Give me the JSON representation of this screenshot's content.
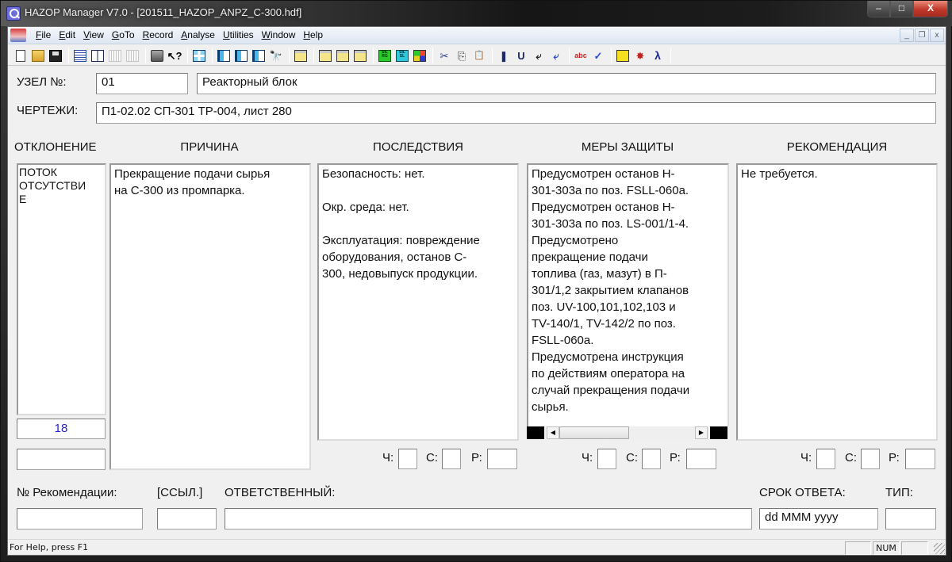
{
  "window": {
    "title": "HAZOP Manager V7.0 - [201511_HAZOP_ANPZ_C-300.hdf]",
    "controls": {
      "minimize": "–",
      "maximize": "□",
      "close": "X"
    },
    "mdi_controls": {
      "minimize": "_",
      "restore": "❐",
      "close": "x"
    }
  },
  "menu": {
    "items": [
      {
        "label": "File",
        "accel": "F",
        "rest": "ile"
      },
      {
        "label": "Edit",
        "accel": "E",
        "rest": "dit"
      },
      {
        "label": "View",
        "accel": "V",
        "rest": "iew"
      },
      {
        "label": "GoTo",
        "accel": "G",
        "rest": "oTo"
      },
      {
        "label": "Record",
        "accel": "R",
        "rest": "ecord"
      },
      {
        "label": "Analyse",
        "accel": "A",
        "rest": "nalyse"
      },
      {
        "label": "Utilities",
        "accel": "U",
        "rest": "tilities"
      },
      {
        "label": "Window",
        "accel": "W",
        "rest": "indow"
      },
      {
        "label": "Help",
        "accel": "H",
        "rest": "elp"
      }
    ]
  },
  "toolbar": {
    "buttons": [
      {
        "name": "new-document-icon"
      },
      {
        "name": "open-folder-icon"
      },
      {
        "name": "save-disk-icon"
      },
      {
        "name": "worksheet-list-icon"
      },
      {
        "name": "node-grid-icon"
      },
      {
        "name": "disabled-columns-icon"
      },
      {
        "name": "disabled-sign-icon"
      },
      {
        "name": "print-icon"
      },
      {
        "name": "context-help-icon",
        "glyph": "↖?"
      },
      {
        "name": "insert-record-icon"
      },
      {
        "name": "previous-record-icon"
      },
      {
        "name": "next-record-icon"
      },
      {
        "name": "goto-record-icon"
      },
      {
        "name": "find-number-icon",
        "glyph": "🔭"
      },
      {
        "name": "add-row-icon"
      },
      {
        "name": "highlight-icon"
      },
      {
        "name": "move-row-icon"
      },
      {
        "name": "resize-row-icon"
      },
      {
        "name": "sil-rg-icon",
        "glyph": "SIL RG"
      },
      {
        "name": "sil-sl-icon",
        "glyph": "SIL SL"
      },
      {
        "name": "risk-matrix-icon"
      },
      {
        "name": "cut-icon",
        "glyph": "✂"
      },
      {
        "name": "copy-icon",
        "glyph": "⎘"
      },
      {
        "name": "paste-icon",
        "glyph": "📋"
      },
      {
        "name": "bookmark-icon",
        "glyph": "❚"
      },
      {
        "name": "undo-icon",
        "glyph": "U"
      },
      {
        "name": "return-ar-icon",
        "glyph": "⤶"
      },
      {
        "name": "return-er-icon",
        "glyph": "⤶"
      },
      {
        "name": "find-text-icon",
        "glyph": "abc"
      },
      {
        "name": "spell-check-icon",
        "glyph": "✓"
      },
      {
        "name": "report-icon"
      },
      {
        "name": "db-explode-icon",
        "glyph": "✸"
      },
      {
        "name": "db-lambda-icon",
        "glyph": "λ"
      }
    ]
  },
  "node": {
    "label": "УЗЕЛ №:",
    "number": "01",
    "name": "Реакторный блок"
  },
  "drawings": {
    "label": "ЧЕРТЕЖИ:",
    "value": "П1-02.02 СП-301 ТР-004, лист 280"
  },
  "columns": {
    "deviation": "ОТКЛОНЕНИЕ",
    "cause": "ПРИЧИНА",
    "consequences": "ПОСЛЕДСТВИЯ",
    "safeguards": "МЕРЫ ЗАЩИТЫ",
    "recommendation": "РЕКОМЕНДАЦИЯ"
  },
  "record": {
    "deviation": "ПОТОК\nОТСУТСТВИ\nЕ",
    "deviation_number": "18",
    "deviation_extra": "",
    "cause": "Прекращение подачи сырья\nна С-300 из промпарка.",
    "consequences": "Безопасность: нет.\n\nОкр. среда: нет.\n\nЭксплуатация: повреждение\nоборудования, останов С-\n300, недовыпуск продукции.",
    "safeguards": "Предусмотрен останов Н-\n301-303а по поз. FSLL-060а.\nПредусмотрен останов Н-\n301-303а по поз. LS-001/1-4.\nПредусмотрено\nпрекращение подачи\nтоплива (газ, мазут) в П-\n301/1,2 закрытием клапанов\nпоз. UV-100,101,102,103 и\nTV-140/1, TV-142/2 по поз.\nFSLL-060а.\nПредусмотрена инструкция\nпо действиям оператора на\nслучай прекращения подачи\nсырья.",
    "recommendation": "Не требуется."
  },
  "risk": {
    "labels": {
      "frequency": "Ч:",
      "severity": "С:",
      "risk": "Р:"
    },
    "consequences": {
      "frequency": "",
      "severity": "",
      "risk": ""
    },
    "safeguards": {
      "frequency": "",
      "severity": "",
      "risk": ""
    },
    "recommendation": {
      "frequency": "",
      "severity": "",
      "risk": ""
    }
  },
  "bottom": {
    "rec_number_label": "№ Рекомендации:",
    "rec_number_value": "",
    "ref_label": "[ССЫЛ.]",
    "ref_value": "",
    "responsible_label": "ОТВЕТСТВЕННЫЙ:",
    "responsible_value": "",
    "due_label": "СРОК ОТВЕТА:",
    "due_value": "dd MMM yyyy",
    "type_label": "ТИП:",
    "type_value": ""
  },
  "statusbar": {
    "help_text": "For Help, press F1",
    "pane1": "",
    "pane2": "NUM",
    "pane3": ""
  }
}
